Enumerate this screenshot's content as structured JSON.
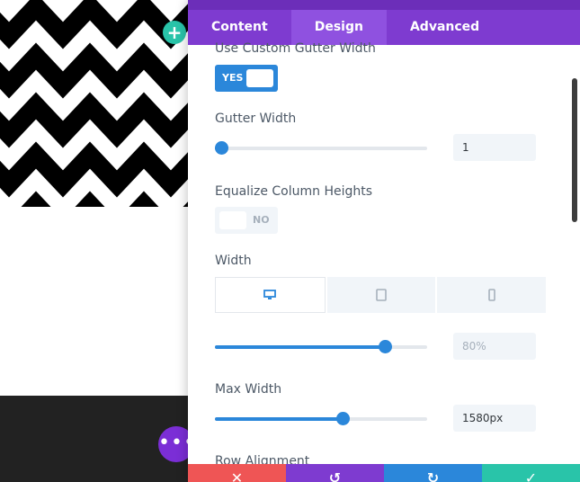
{
  "canvas": {
    "add_icon": "+",
    "more_icon": "•••"
  },
  "panel": {
    "tabs": [
      {
        "label": "Content",
        "active": false
      },
      {
        "label": "Design",
        "active": true
      },
      {
        "label": "Advanced",
        "active": false
      }
    ],
    "use_custom_gutter": {
      "label": "Use Custom Gutter Width",
      "toggle_text": "YES",
      "on": true
    },
    "gutter_width": {
      "label": "Gutter Width",
      "value": "1",
      "slider_fraction": 0.03
    },
    "equalize_heights": {
      "label": "Equalize Column Heights",
      "toggle_text": "NO",
      "on": false
    },
    "width": {
      "label": "Width",
      "devices": [
        "desktop-icon",
        "tablet-icon",
        "phone-icon"
      ],
      "active_device": "desktop",
      "value": "80%",
      "slider_fraction": 0.8
    },
    "max_width": {
      "label": "Max Width",
      "value": "1580px",
      "slider_fraction": 0.6
    },
    "next_section_label": "Row Alignment",
    "actions": [
      {
        "name": "discard",
        "icon": "✕",
        "color": "#ef5555"
      },
      {
        "name": "undo",
        "icon": "↺",
        "color": "#7e3bd0"
      },
      {
        "name": "redo",
        "icon": "↻",
        "color": "#2b87da"
      },
      {
        "name": "save",
        "icon": "✓",
        "color": "#29c4a9"
      }
    ]
  },
  "colors": {
    "accent": "#2b87da",
    "tab_bar": "#7e3bd0",
    "tab_active": "#8f51e0",
    "teal": "#29c4a9"
  }
}
